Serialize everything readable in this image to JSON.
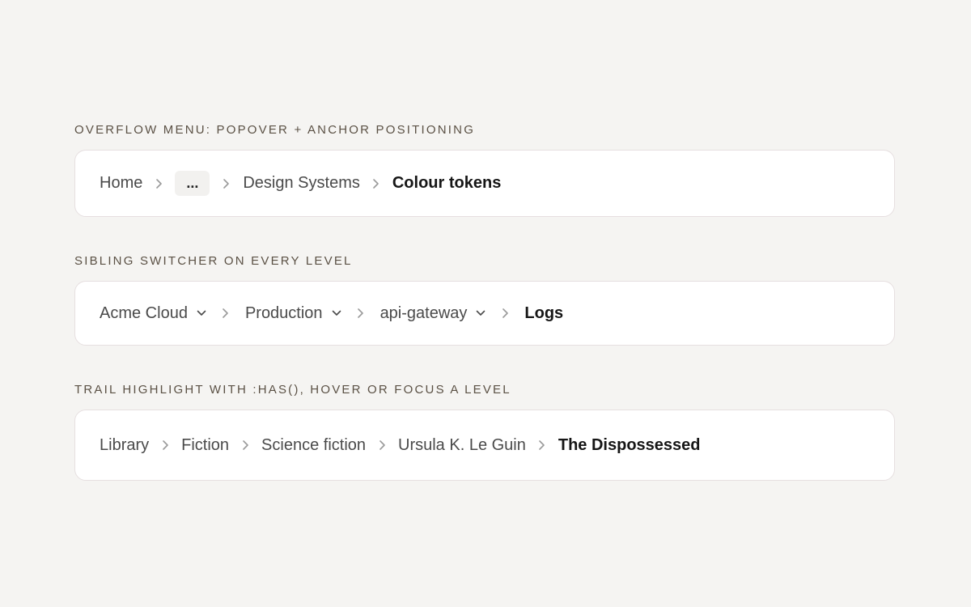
{
  "sections": [
    {
      "label": "OVERFLOW MENU: POPOVER + ANCHOR POSITIONING",
      "crumbs": [
        {
          "label": "Home"
        },
        {
          "label": "..."
        },
        {
          "label": "Design Systems"
        },
        {
          "label": "Colour tokens",
          "current": true
        }
      ]
    },
    {
      "label": "SIBLING SWITCHER ON EVERY LEVEL",
      "crumbs": [
        {
          "label": "Acme Cloud",
          "dropdown": true
        },
        {
          "label": "Production",
          "dropdown": true
        },
        {
          "label": "api-gateway",
          "dropdown": true
        },
        {
          "label": "Logs",
          "current": true
        }
      ]
    },
    {
      "label": "TRAIL HIGHLIGHT WITH :HAS(), HOVER OR FOCUS A LEVEL",
      "crumbs": [
        {
          "label": "Library"
        },
        {
          "label": "Fiction"
        },
        {
          "label": "Science fiction"
        },
        {
          "label": "Ursula K. Le Guin"
        },
        {
          "label": "The Dispossessed",
          "current": true
        }
      ]
    }
  ],
  "icons": {
    "separator": "chevron-right-icon",
    "dropdown": "chevron-down-icon"
  },
  "colors": {
    "background": "#f5f4f2",
    "card": "#ffffff",
    "card_border": "#e6dfe0",
    "label": "#5b5145",
    "crumb_text": "#4a4a4a",
    "current_text": "#161616",
    "separator": "#9a9a9a",
    "more_button_bg": "#f2f1ef"
  }
}
